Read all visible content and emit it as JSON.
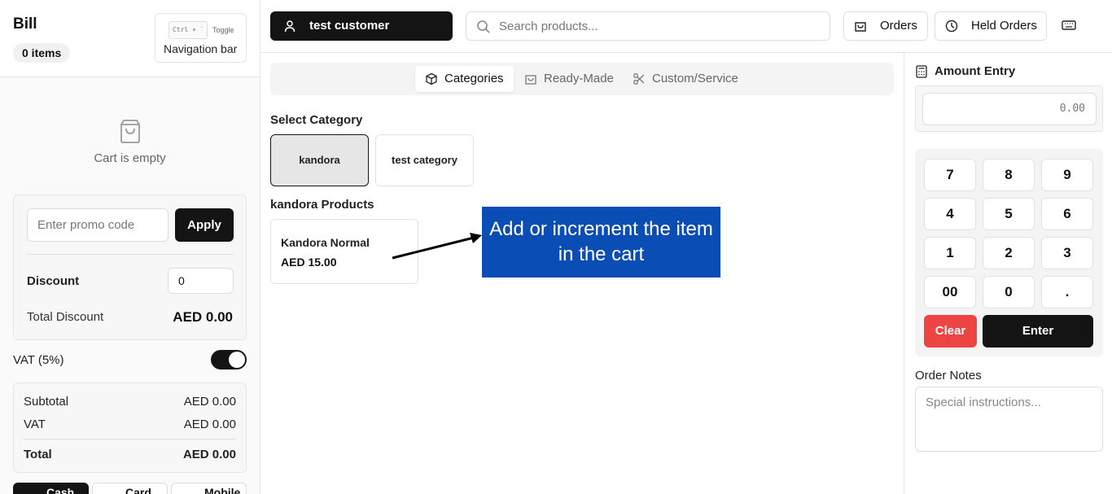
{
  "bill": {
    "title": "Bill",
    "items_count": "0 items",
    "nav_shortcut": "Ctrl + `",
    "nav_toggle_small": "Toggle",
    "nav_label": "Navigation bar",
    "empty_text": "Cart is empty",
    "promo_placeholder": "Enter promo code",
    "apply_label": "Apply",
    "discount_label": "Discount",
    "discount_value": "0",
    "total_discount_label": "Total Discount",
    "total_discount_value": "AED 0.00",
    "vat_label": "VAT (5%)",
    "vat_enabled": true,
    "subtotal_label": "Subtotal",
    "subtotal_value": "AED 0.00",
    "vat_row_label": "VAT",
    "vat_row_value": "AED 0.00",
    "total_label": "Total",
    "total_value": "AED 0.00",
    "payment_methods": [
      "Cash",
      "Card",
      "Mobile"
    ]
  },
  "topbar": {
    "customer": "test customer",
    "search_placeholder": "Search products...",
    "orders_label": "Orders",
    "held_orders_label": "Held Orders"
  },
  "tabs": {
    "categories": "Categories",
    "ready_made": "Ready-Made",
    "custom_service": "Custom/Service"
  },
  "catalog": {
    "select_category_label": "Select Category",
    "categories": [
      "kandora",
      "test category"
    ],
    "active_category": "kandora",
    "products_title": "kandora Products",
    "products": [
      {
        "name": "Kandora Normal",
        "price": "AED 15.00"
      }
    ]
  },
  "annotation": {
    "text": "Add or increment the item in the cart"
  },
  "amount_entry": {
    "title": "Amount Entry",
    "value": "0.00",
    "keys": [
      "7",
      "8",
      "9",
      "4",
      "5",
      "6",
      "1",
      "2",
      "3",
      "00",
      "0",
      "."
    ],
    "clear_label": "Clear",
    "enter_label": "Enter"
  },
  "order_notes": {
    "title": "Order Notes",
    "placeholder": "Special instructions..."
  },
  "colors": {
    "primary_dark": "#141414",
    "danger": "#ef4444",
    "callout_blue": "#0a4db5"
  }
}
